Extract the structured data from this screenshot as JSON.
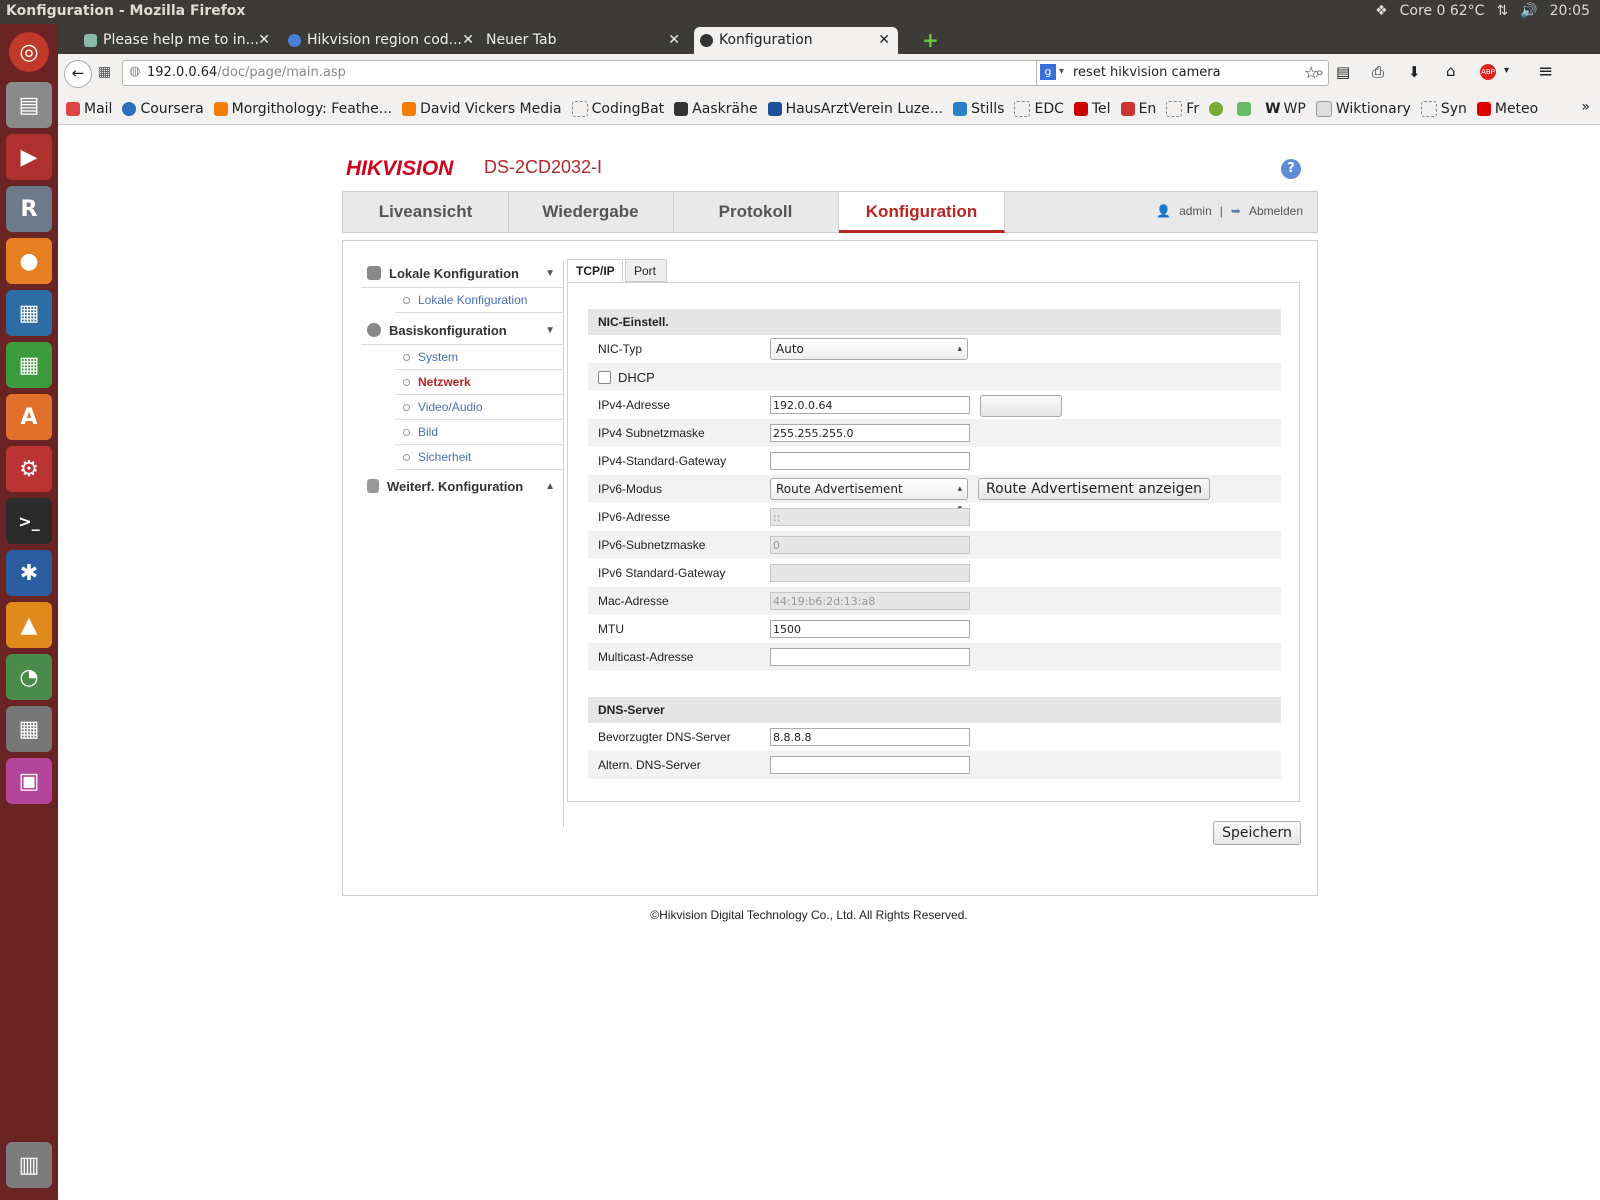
{
  "os": {
    "window_title": "Konfiguration - Mozilla Firefox",
    "cpu_temp": "Core 0 62°C",
    "clock": "20:05"
  },
  "browser": {
    "tabs": [
      {
        "label": "Please help me to in..."
      },
      {
        "label": "Hikvision region cod..."
      },
      {
        "label": "Neuer Tab"
      },
      {
        "label": "Konfiguration"
      }
    ],
    "url_host": "192.0.0.64",
    "url_path": "/doc/page/main.asp",
    "search_value": "reset hikvision camera",
    "bookmarks": [
      "Mail",
      "Coursera",
      "Morgithology: Feathe...",
      "David Vickers Media",
      "CodingBat",
      "Aaskrähe",
      "HausArztVerein Luze...",
      "Stills",
      "EDC",
      "Tel",
      "En",
      "Fr",
      "WP",
      "Wiktionary",
      "Syn",
      "Meteo"
    ]
  },
  "header": {
    "brand": "HIKVISION",
    "model": "DS-2CD2032-I",
    "help": "?"
  },
  "nav": {
    "tabs": [
      {
        "label": "Liveansicht"
      },
      {
        "label": "Wiedergabe"
      },
      {
        "label": "Protokoll"
      },
      {
        "label": "Konfiguration"
      }
    ],
    "user": "admin",
    "separator": "|",
    "logout": "Abmelden"
  },
  "sidebar": {
    "groups": [
      {
        "label": "Lokale Konfiguration",
        "items": [
          "Lokale Konfiguration"
        ]
      },
      {
        "label": "Basiskonfiguration",
        "items": [
          "System",
          "Netzwerk",
          "Video/Audio",
          "Bild",
          "Sicherheit"
        ]
      },
      {
        "label": "Weiterf. Konfiguration",
        "items": []
      }
    ]
  },
  "subtabs": [
    "TCP/IP",
    "Port"
  ],
  "form": {
    "nic_section": "NIC-Einstell.",
    "nic_type_label": "NIC-Typ",
    "nic_type_value": "Auto",
    "dhcp_label": "DHCP",
    "ipv4_label": "IPv4-Adresse",
    "ipv4_value": "192.0.0.64",
    "subnet_label": "IPv4 Subnetzmaske",
    "subnet_value": "255.255.255.0",
    "gateway_label": "IPv4-Standard-Gateway",
    "gateway_value": "",
    "ipv6_mode_label": "IPv6-Modus",
    "ipv6_mode_value": "Route Advertisement",
    "ra_button": "Route Advertisement anzeigen",
    "ipv6_addr_label": "IPv6-Adresse",
    "ipv6_addr_value": "::",
    "ipv6_subnet_label": "IPv6-Subnetzmaske",
    "ipv6_subnet_value": "0",
    "ipv6_gateway_label": "IPv6 Standard-Gateway",
    "ipv6_gateway_value": "",
    "mac_label": "Mac-Adresse",
    "mac_value": "44:19:b6:2d:13:a8",
    "mtu_label": "MTU",
    "mtu_value": "1500",
    "multicast_label": "Multicast-Adresse",
    "multicast_value": "",
    "dns_section": "DNS-Server",
    "dns1_label": "Bevorzugter DNS-Server",
    "dns1_value": "8.8.8.8",
    "dns2_label": "Altern. DNS-Server",
    "dns2_value": "",
    "save_button": "Speichern"
  },
  "footer": "©Hikvision Digital Technology Co., Ltd. All Rights Reserved.",
  "colors": {
    "accent": "#b8241f",
    "link": "#4a6fb5",
    "launcher": "#6a2424"
  }
}
